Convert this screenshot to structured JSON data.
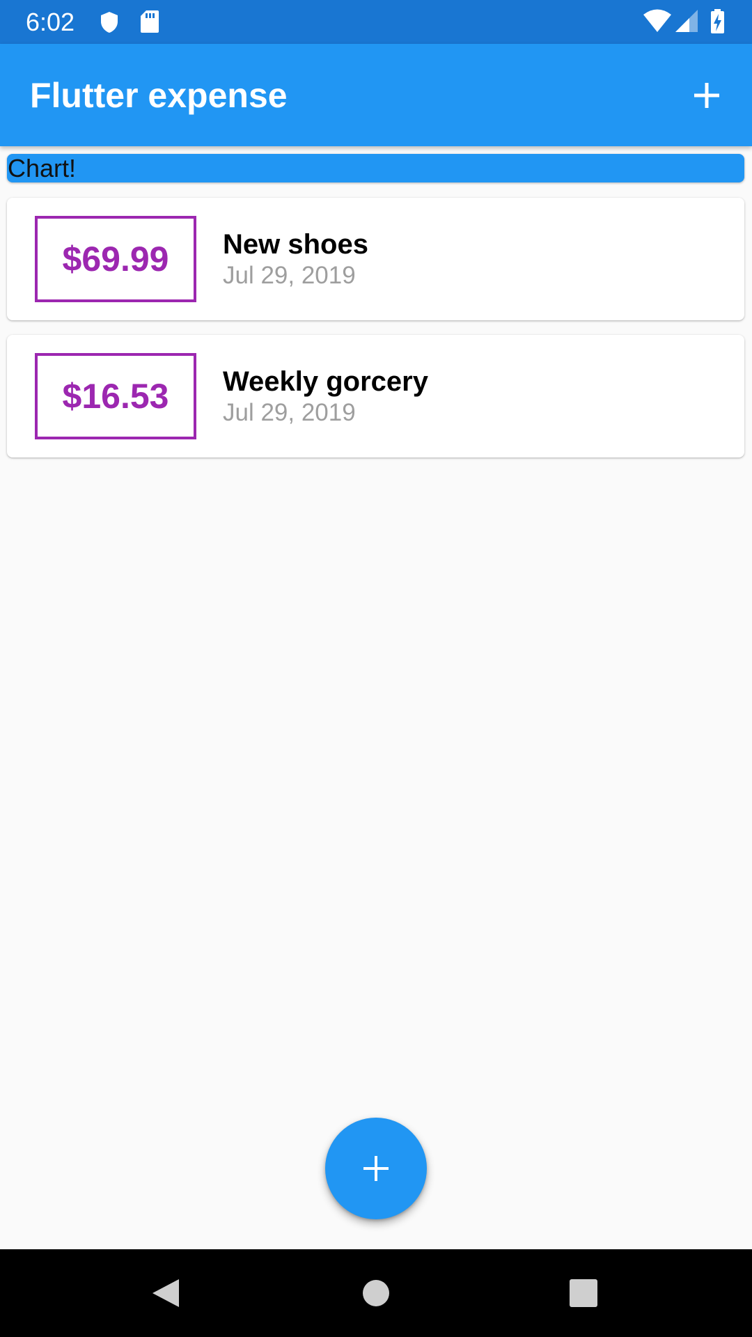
{
  "status_bar": {
    "time": "6:02",
    "icons": [
      "shield-icon",
      "sd-card-icon",
      "wifi-icon",
      "signal-icon",
      "battery-charging-icon"
    ]
  },
  "app_bar": {
    "title": "Flutter expense",
    "action_icon": "add-icon"
  },
  "chart": {
    "label": "Chart!"
  },
  "transactions": [
    {
      "amount": "$69.99",
      "title": "New shoes",
      "date": "Jul 29, 2019"
    },
    {
      "amount": "$16.53",
      "title": "Weekly gorcery",
      "date": "Jul 29, 2019"
    }
  ],
  "fab": {
    "icon": "add-icon"
  },
  "nav_bar": {
    "buttons": [
      "back-icon",
      "home-icon",
      "recents-icon"
    ]
  },
  "colors": {
    "status_bar": "#1976d2",
    "primary": "#2196f3",
    "accent_purple": "#9c27b0",
    "date_gray": "#9e9e9e",
    "background": "#fafafa"
  }
}
